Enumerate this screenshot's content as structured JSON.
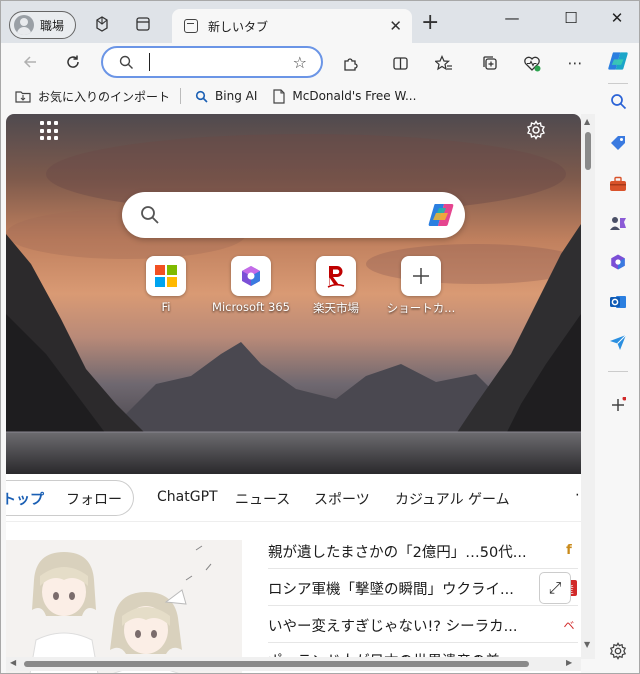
{
  "titlebar": {
    "profile_label": "職場",
    "tab_title": "新しいタブ",
    "tab_close": "✕",
    "new_tab": "+",
    "minimize": "—",
    "maximize": "☐",
    "close": "✕"
  },
  "toolbar": {
    "address_value": "",
    "address_placeholder": ""
  },
  "favorites": {
    "items": [
      {
        "label": "お気に入りのインポート",
        "icon": "import-folder-icon"
      },
      {
        "label": "Bing AI",
        "icon": "search-icon"
      },
      {
        "label": "McDonald's Free W...",
        "icon": "document-icon"
      }
    ]
  },
  "newtab": {
    "quicklinks": [
      {
        "label": "Fi",
        "icon": "microsoft-logo-icon"
      },
      {
        "label": "Microsoft 365",
        "icon": "m365-icon"
      },
      {
        "label": "楽天市場",
        "icon": "rakuten-icon"
      },
      {
        "label": "ショートカ...",
        "icon": "plus-icon"
      }
    ]
  },
  "news": {
    "tabs": [
      {
        "label": "トップ",
        "active": true
      },
      {
        "label": "フォロー",
        "active": false
      },
      {
        "label": "ChatGPT",
        "active": false
      },
      {
        "label": "ニュース",
        "active": false
      },
      {
        "label": "スポーツ",
        "active": false
      },
      {
        "label": "カジュアル ゲーム",
        "active": false
      }
    ],
    "more": "⋯",
    "headlines": [
      {
        "text": "親が遺したまさかの「2億円」…50代...",
        "source_icon": "f",
        "source_color": "#c98a1a"
      },
      {
        "text": "ロシア軍機「撃墜の瞬間」ウクライ...",
        "source_icon": "産",
        "source_color": "#d12a2a"
      },
      {
        "text": "いやー変えすぎじゃない!? シーラカ...",
        "source_icon": "ベ",
        "source_color": "#d12a2a"
      },
      {
        "text": "ポーランド人が日本の世界遺産の美...",
        "source_icon": "●",
        "source_color": "#d12a2a"
      }
    ]
  },
  "colors": {
    "accent": "#1a5fb4",
    "address_border": "#6b95e6"
  }
}
